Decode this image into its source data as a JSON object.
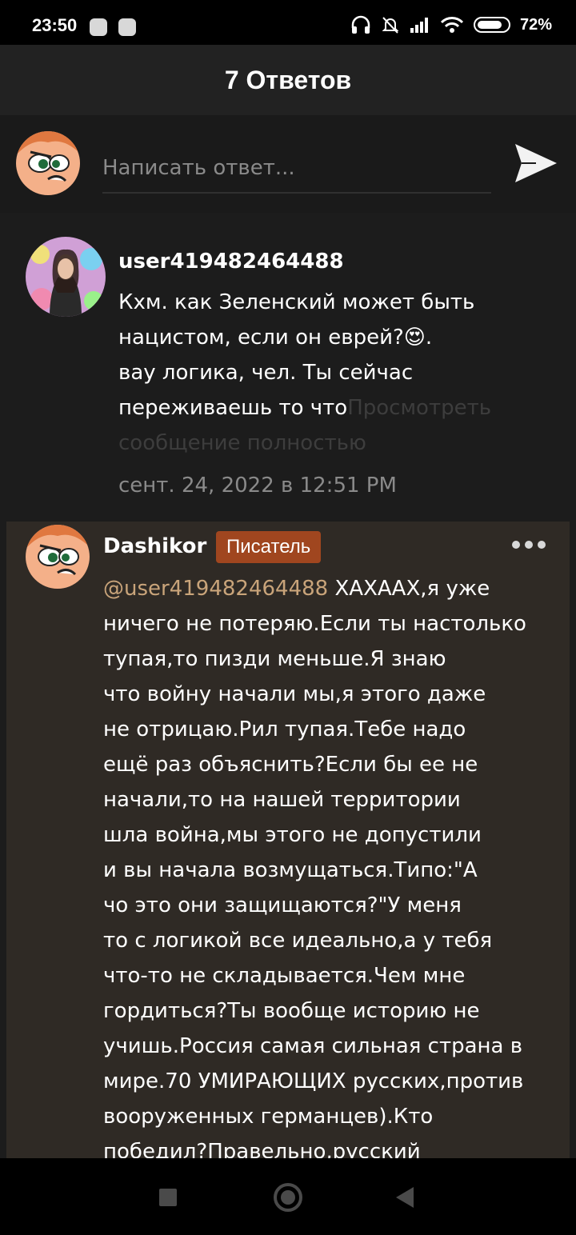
{
  "status_bar": {
    "time": "23:50",
    "battery": "72%"
  },
  "header": {
    "title": "7 Ответов"
  },
  "composer": {
    "placeholder": "Написать ответ..."
  },
  "comment1": {
    "username": "user419482464488",
    "lines": [
      "Кхм. как Зеленский может быть",
      "нацистом, если он еврей?",
      "вау логика, чел. Ты сейчас",
      "переживаешь то что"
    ],
    "emoji": "😍",
    "line2_tail": ".",
    "view_full_part1": "Просмотреть",
    "view_full_part2": "сообщение полностью",
    "timestamp": "сент. 24, 2022 в 12:51 PM"
  },
  "comment2": {
    "username": "Dashikor",
    "badge": "Писатель",
    "mention": "@user419482464488",
    "first_line_rest": " ХАХААХ,я уже",
    "lines": [
      "ничего не потеряю.Если ты настолько",
      "тупая,то пизди меньше.Я знаю",
      "что войну начали мы,я этого даже",
      "не отрицаю.Рил тупая.Тебе надо",
      "ещё раз объяснить?Если бы ее не",
      "начали,то на нашей территории",
      "шла война,мы этого не допустили",
      "и вы начала возмущаться.Типо:\"А",
      "чо это они защищаются?\"У меня",
      "то с логикой все идеально,а у тебя",
      "что-то не складывается.Чем мне",
      "гордиться?Ты вообще историю не",
      "учишь.Россия самая сильная страна в",
      "мире.70 УМИРАЮЩИХ русских,против",
      "вооруженных германцев).Кто",
      "победил?Правельно,русский"
    ]
  }
}
